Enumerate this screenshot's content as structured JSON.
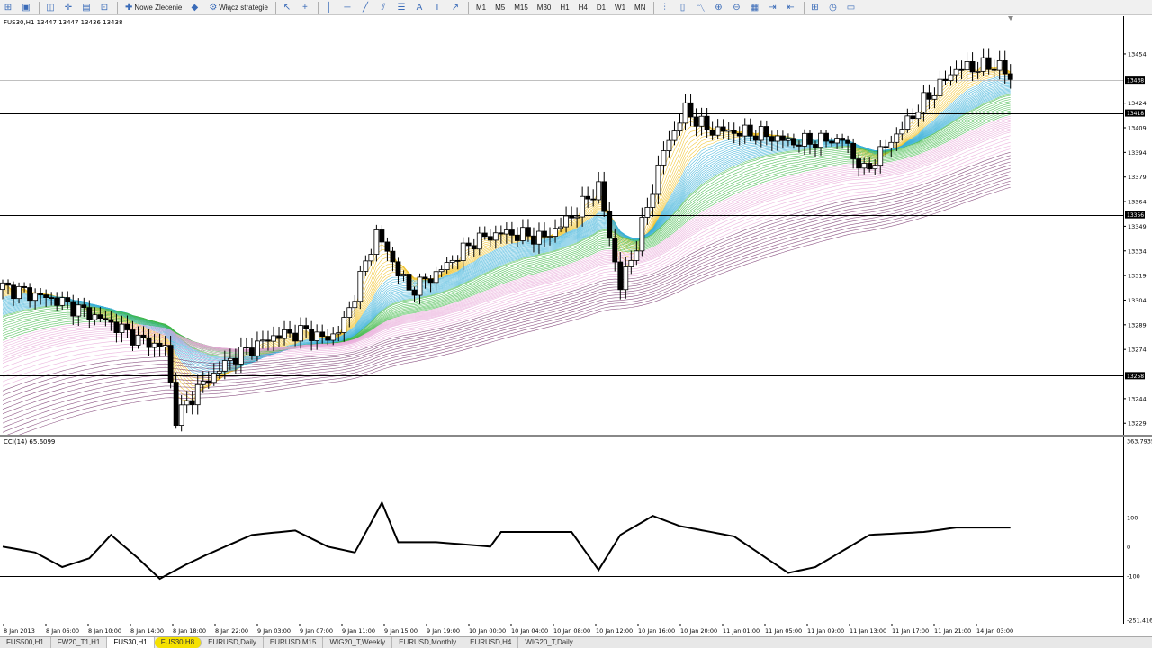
{
  "toolbar": {
    "items": [
      {
        "kind": "icon",
        "name": "new-chart-icon",
        "glyph": "⊞"
      },
      {
        "kind": "icon",
        "name": "profiles-icon",
        "glyph": "▣"
      },
      {
        "kind": "sep"
      },
      {
        "kind": "icon",
        "name": "market-watch-icon",
        "glyph": "◫"
      },
      {
        "kind": "icon",
        "name": "navigator-icon",
        "glyph": "✛"
      },
      {
        "kind": "icon",
        "name": "terminal-icon",
        "glyph": "▤"
      },
      {
        "kind": "icon",
        "name": "tester-icon",
        "glyph": "⊡"
      },
      {
        "kind": "sep"
      },
      {
        "kind": "text",
        "name": "new-order-button",
        "glyph": "✚",
        "label": "Nowe Zlecenie"
      },
      {
        "kind": "icon",
        "name": "metaeditor-icon",
        "glyph": "◆"
      },
      {
        "kind": "text",
        "name": "auto-trading-button",
        "glyph": "⚙",
        "label": "Włącz strategie"
      },
      {
        "kind": "sep"
      },
      {
        "kind": "icon",
        "name": "cursor-icon",
        "glyph": "↖"
      },
      {
        "kind": "icon",
        "name": "crosshair-icon",
        "glyph": "+"
      },
      {
        "kind": "sep"
      },
      {
        "kind": "icon",
        "name": "vertical-line-icon",
        "glyph": "│"
      },
      {
        "kind": "icon",
        "name": "horizontal-line-icon",
        "glyph": "─"
      },
      {
        "kind": "icon",
        "name": "trendline-icon",
        "glyph": "╱"
      },
      {
        "kind": "icon",
        "name": "channel-icon",
        "glyph": "⫽"
      },
      {
        "kind": "icon",
        "name": "fibonacci-icon",
        "glyph": "☰"
      },
      {
        "kind": "icon",
        "name": "text-icon",
        "glyph": "A"
      },
      {
        "kind": "icon",
        "name": "label-icon",
        "glyph": "T"
      },
      {
        "kind": "icon",
        "name": "shapes-icon",
        "glyph": "↗"
      },
      {
        "kind": "sep"
      },
      {
        "kind": "text",
        "name": "period-m1",
        "label": "M1"
      },
      {
        "kind": "text",
        "name": "period-m5",
        "label": "M5"
      },
      {
        "kind": "text",
        "name": "period-m15",
        "label": "M15"
      },
      {
        "kind": "text",
        "name": "period-m30",
        "label": "M30"
      },
      {
        "kind": "text",
        "name": "period-h1",
        "label": "H1"
      },
      {
        "kind": "text",
        "name": "period-h4",
        "label": "H4"
      },
      {
        "kind": "text",
        "name": "period-d1",
        "label": "D1"
      },
      {
        "kind": "text",
        "name": "period-w1",
        "label": "W1"
      },
      {
        "kind": "text",
        "name": "period-mn",
        "label": "MN"
      },
      {
        "kind": "sep"
      },
      {
        "kind": "icon",
        "name": "bar-chart-icon",
        "glyph": "⫶"
      },
      {
        "kind": "icon",
        "name": "candles-icon",
        "glyph": "▯"
      },
      {
        "kind": "icon",
        "name": "line-chart-icon",
        "glyph": "〽"
      },
      {
        "kind": "icon",
        "name": "zoom-in-icon",
        "glyph": "⊕"
      },
      {
        "kind": "icon",
        "name": "zoom-out-icon",
        "glyph": "⊖"
      },
      {
        "kind": "icon",
        "name": "tile-icon",
        "glyph": "▦"
      },
      {
        "kind": "icon",
        "name": "autoscroll-icon",
        "glyph": "⇥"
      },
      {
        "kind": "icon",
        "name": "chart-shift-icon",
        "glyph": "⇤"
      },
      {
        "kind": "sep"
      },
      {
        "kind": "icon",
        "name": "indicators-icon",
        "glyph": "⊞"
      },
      {
        "kind": "icon",
        "name": "periods-icon",
        "glyph": "◷"
      },
      {
        "kind": "icon",
        "name": "templates-icon",
        "glyph": "▭"
      }
    ]
  },
  "chart": {
    "header": "FUS30,H1  13447 13447 13436 13438",
    "cci_header": "CCI(14) 65.6099",
    "colors": {
      "bull": "#ffffff",
      "bear": "#000000",
      "ribbon_short": "#f0c020",
      "ribbon_mid": "#3ab0d8",
      "ribbon_long": "#40b848",
      "ribbon_far": "#e8a8d8",
      "ribbon_deep": "#7a3a70"
    },
    "hlines": [
      13438,
      13418,
      13356,
      13258
    ],
    "hline_labels": {
      "13438": "13438",
      "13418": "13418",
      "13356": "13356",
      "13258": "13258"
    }
  },
  "chart_data": [
    {
      "type": "candlestick",
      "title": "FUS30,H1",
      "y_axis_ticks": [
        13454,
        13424,
        13409,
        13394,
        13379,
        13364,
        13349,
        13334,
        13319,
        13304,
        13289,
        13274,
        13244,
        13229
      ],
      "ylim": [
        13222,
        13477
      ],
      "close_path": [
        [
          0,
          13312
        ],
        [
          10,
          13304
        ],
        [
          20,
          13290
        ],
        [
          25,
          13280
        ],
        [
          30,
          13275
        ],
        [
          32,
          13232
        ],
        [
          36,
          13250
        ],
        [
          42,
          13268
        ],
        [
          50,
          13282
        ],
        [
          56,
          13285
        ],
        [
          60,
          13280
        ],
        [
          63,
          13290
        ],
        [
          69,
          13345
        ],
        [
          75,
          13310
        ],
        [
          80,
          13320
        ],
        [
          87,
          13340
        ],
        [
          92,
          13345
        ],
        [
          100,
          13342
        ],
        [
          105,
          13355
        ],
        [
          110,
          13373
        ],
        [
          114,
          13312
        ],
        [
          117,
          13338
        ],
        [
          122,
          13395
        ],
        [
          126,
          13420
        ],
        [
          130,
          13408
        ],
        [
          140,
          13405
        ],
        [
          146,
          13400
        ],
        [
          155,
          13402
        ],
        [
          159,
          13382
        ],
        [
          165,
          13405
        ],
        [
          170,
          13425
        ],
        [
          176,
          13445
        ],
        [
          184,
          13447
        ],
        [
          186,
          13438
        ]
      ]
    },
    {
      "type": "line",
      "title": "CCI(14)",
      "series": [
        {
          "name": "CCI(14)",
          "current": 65.6099
        }
      ],
      "levels": [
        100,
        0,
        -100
      ],
      "y_axis_ticks": [
        363.7935,
        100,
        0.0,
        -100,
        -251.4163
      ],
      "ylim": [
        -251.4163,
        363.7935
      ],
      "values": [
        [
          0,
          0
        ],
        [
          6,
          -20
        ],
        [
          11,
          -70
        ],
        [
          16,
          -40
        ],
        [
          20,
          40
        ],
        [
          25,
          -40
        ],
        [
          29,
          -110
        ],
        [
          34,
          -60
        ],
        [
          38,
          -25
        ],
        [
          46,
          40
        ],
        [
          54,
          55
        ],
        [
          60,
          0
        ],
        [
          65,
          -20
        ],
        [
          70,
          150
        ],
        [
          73,
          15
        ],
        [
          80,
          15
        ],
        [
          90,
          0
        ],
        [
          92,
          50
        ],
        [
          98,
          50
        ],
        [
          105,
          50
        ],
        [
          110,
          -80
        ],
        [
          114,
          40
        ],
        [
          120,
          105
        ],
        [
          125,
          70
        ],
        [
          135,
          35
        ],
        [
          145,
          -90
        ],
        [
          150,
          -70
        ],
        [
          160,
          40
        ],
        [
          170,
          50
        ],
        [
          176,
          65
        ]
      ]
    }
  ],
  "time_axis": [
    "8 Jan 2013",
    "8 Jan 06:00",
    "8 Jan 10:00",
    "8 Jan 14:00",
    "8 Jan 18:00",
    "8 Jan 22:00",
    "9 Jan 03:00",
    "9 Jan 07:00",
    "9 Jan 11:00",
    "9 Jan 15:00",
    "9 Jan 19:00",
    "10 Jan 00:00",
    "10 Jan 04:00",
    "10 Jan 08:00",
    "10 Jan 12:00",
    "10 Jan 16:00",
    "10 Jan 20:00",
    "11 Jan 01:00",
    "11 Jan 05:00",
    "11 Jan 09:00",
    "11 Jan 13:00",
    "11 Jan 17:00",
    "11 Jan 21:00",
    "14 Jan 03:00"
  ],
  "tabs": [
    {
      "label": "FUS500,H1",
      "active": false
    },
    {
      "label": "FW20_T1,H1",
      "active": false
    },
    {
      "label": "FUS30,H1",
      "active": true
    },
    {
      "label": "FUS30,H8",
      "active": false,
      "highlight": true
    },
    {
      "label": "EURUSD,Daily",
      "active": false
    },
    {
      "label": "EURUSD,M15",
      "active": false
    },
    {
      "label": "WIG20_T,Weekly",
      "active": false
    },
    {
      "label": "EURUSD,Monthly",
      "active": false
    },
    {
      "label": "EURUSD,H4",
      "active": false
    },
    {
      "label": "WIG20_T,Daily",
      "active": false
    }
  ]
}
